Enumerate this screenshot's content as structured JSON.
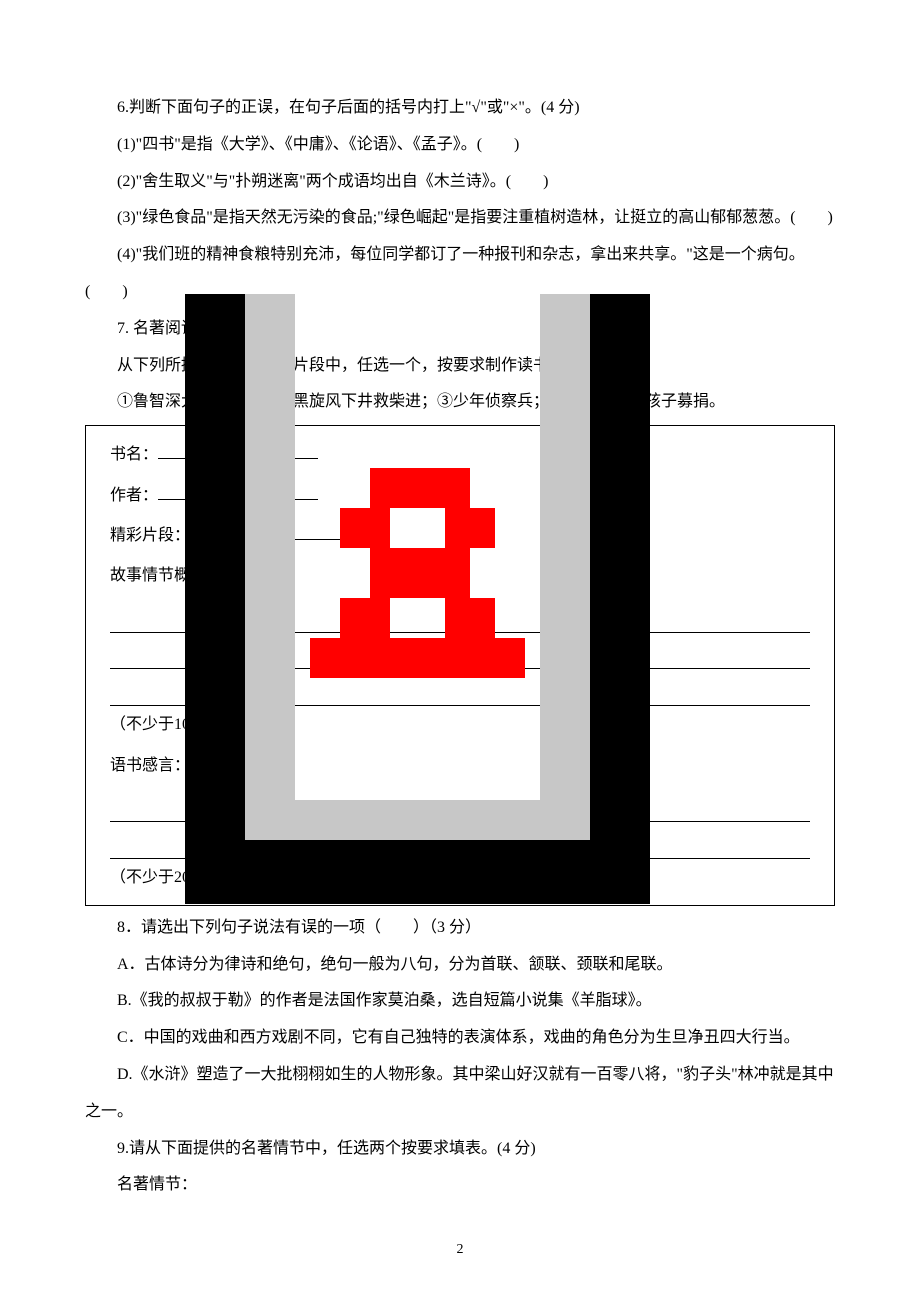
{
  "q6": {
    "stem": "6.判断下面句子的正误，在句子后面的括号内打上\"√\"或\"×\"。(4 分)",
    "items": [
      "(1)\"四书\"是指《大学》、《中庸》、《论语》、《孟子》。(　　)",
      "(2)\"舍生取义\"与\"扑朔迷离\"两个成语均出自《木兰诗》。(　　)",
      "(3)\"绿色食品\"是指天然无污染的食品;\"绿色崛起\"是指要注重植树造林，让挺立的高山郁郁葱葱。(　　)",
      "(4)\"我们班的精神食粮特别充沛，每位同学都订了一种报刊和杂志，拿出来共享。\"这是一个病句。(　　)"
    ]
  },
  "q7": {
    "stem": "7. 名著阅读。(10 分)",
    "instr": "从下列所提供的名著精彩片段中，任选一个，按要求制作读书卡片。",
    "choices": "①鲁智深大闹五台山；②黑旋风下井救柴进；③少年侦察兵；④为扫烟囱的孩子募捐。",
    "card": {
      "book": "书名：",
      "author": "作者：",
      "excerpt": "精彩片段：",
      "plot": "故事情节概述：",
      "plot_tail": "（不少于100 字）",
      "reflection": "语书感言：",
      "reflection_tail": "（不少于20 字）"
    }
  },
  "q8": {
    "stem": "8．请选出下列句子说法有误的一项（　　）（3 分）",
    "options": [
      "A．古体诗分为律诗和绝句，绝句一般为八句，分为首联、颔联、颈联和尾联。",
      "B.《我的叔叔于勒》的作者是法国作家莫泊桑，选自短篇小说集《羊脂球》。",
      "C．中国的戏曲和西方戏剧不同，它有自己独特的表演体系，戏曲的角色分为生旦净丑四大行当。",
      "D.《水浒》塑造了一大批栩栩如生的人物形象。其中梁山好汉就有一百零八将，\"豹子头\"林冲就是其中之一。"
    ]
  },
  "q9": {
    "stem": "9.请从下面提供的名著情节中，任选两个按要求填表。(4 分)",
    "label": "名著情节："
  },
  "pagenum": "2"
}
